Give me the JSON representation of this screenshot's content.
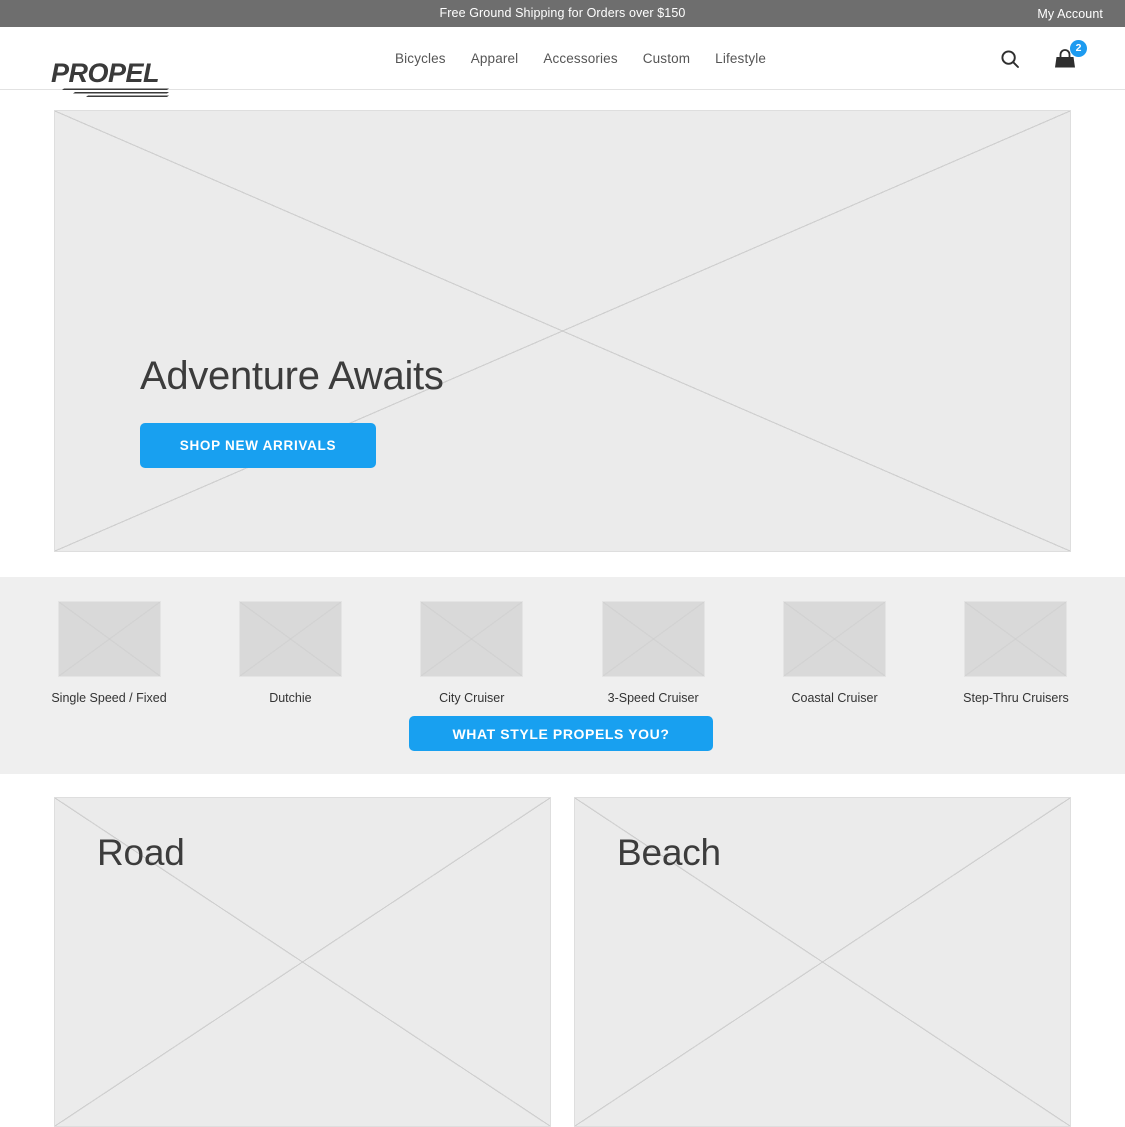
{
  "announcement": {
    "message": "Free Ground Shipping for Orders over $150",
    "account_link": "My Account"
  },
  "header": {
    "logo_text": "PROPEL",
    "nav": [
      {
        "label": "Bicycles"
      },
      {
        "label": "Apparel"
      },
      {
        "label": "Accessories"
      },
      {
        "label": "Custom"
      },
      {
        "label": "Lifestyle"
      }
    ],
    "search_icon": "search-icon",
    "cart_icon": "shopping-bag-icon",
    "cart_count": "2"
  },
  "hero": {
    "title": "Adventure Awaits",
    "cta_label": "SHOP NEW ARRIVALS"
  },
  "categories": {
    "items": [
      {
        "label": "Single Speed / Fixed"
      },
      {
        "label": "Dutchie"
      },
      {
        "label": "City Cruiser"
      },
      {
        "label": "3-Speed Cruiser"
      },
      {
        "label": "Coastal Cruiser"
      },
      {
        "label": "Step-Thru Cruisers"
      }
    ],
    "cta_label": "WHAT STYLE PROPELS YOU?"
  },
  "collections": [
    {
      "title": "Road"
    },
    {
      "title": "Beach"
    }
  ],
  "colors": {
    "accent": "#18a0f0",
    "badge": "#1d9bf0",
    "announcement_bar": "#6e6e6e",
    "strip_background": "#efefef",
    "placeholder_fill": "#ebebeb",
    "heading_text": "#3c3c3c"
  }
}
